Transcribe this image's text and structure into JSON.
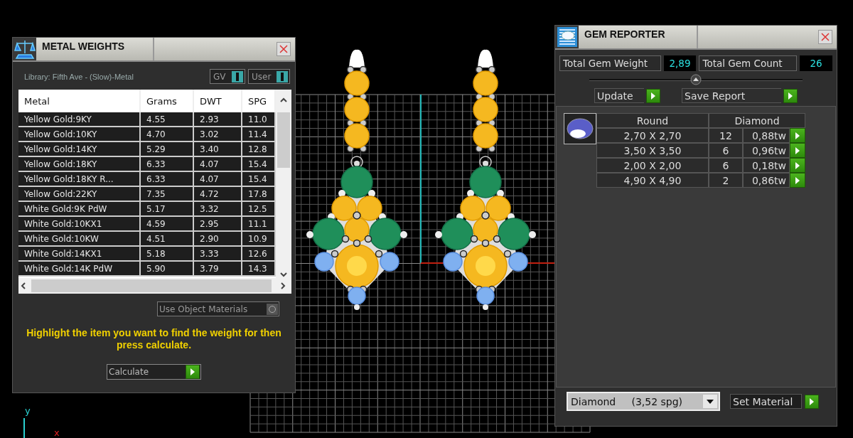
{
  "metal_weights": {
    "title": "METAL WEIGHTS",
    "library": "Library: Fifth Ave - (Slow)-Metal",
    "toggles": [
      {
        "label": "GV",
        "on": true
      },
      {
        "label": "User",
        "on": true
      }
    ],
    "table": {
      "columns": [
        "Metal",
        "Grams",
        "DWT",
        "SPG"
      ],
      "rows": [
        [
          "Yellow Gold:9KY",
          "4.55",
          "2.93",
          "11.0"
        ],
        [
          "Yellow Gold:10KY",
          "4.70",
          "3.02",
          "11.4"
        ],
        [
          "Yellow Gold:14KY",
          "5.29",
          "3.40",
          "12.8"
        ],
        [
          "Yellow Gold:18KY",
          "6.33",
          "4.07",
          "15.4"
        ],
        [
          "Yellow Gold:18KY R...",
          "6.33",
          "4.07",
          "15.4"
        ],
        [
          "Yellow Gold:22KY",
          "7.35",
          "4.72",
          "17.8"
        ],
        [
          "White Gold:9K PdW",
          "5.17",
          "3.32",
          "12.5"
        ],
        [
          "White Gold:10KX1",
          "4.59",
          "2.95",
          "11.1"
        ],
        [
          "White Gold:10KW",
          "4.51",
          "2.90",
          "10.9"
        ],
        [
          "White Gold:14KX1",
          "5.18",
          "3.33",
          "12.6"
        ],
        [
          "White Gold:14K PdW",
          "5.90",
          "3.79",
          "14.3"
        ]
      ]
    },
    "use_object_materials": {
      "label": "Use Object Materials",
      "on": false
    },
    "hint": "Highlight the item you want to find the weight for then press calculate.",
    "calculate_button": "Calculate"
  },
  "viewport": {
    "axis_labels": [
      "y",
      "x"
    ]
  },
  "gem_reporter": {
    "title": "GEM REPORTER",
    "totals": [
      {
        "label": "Total Gem Weight",
        "value": "2,89"
      },
      {
        "label": "Total Gem Count",
        "value": "26"
      }
    ],
    "buttons": [
      "Update",
      "Save Report"
    ],
    "table": {
      "shape": "Round",
      "material": "Diamond",
      "rows": [
        {
          "size": "2,70 X 2,70",
          "count": "12",
          "weight": "0,88tw"
        },
        {
          "size": "3,50 X 3,50",
          "count": "6",
          "weight": "0,96tw"
        },
        {
          "size": "2,00 X 2,00",
          "count": "6",
          "weight": "0,18tw"
        },
        {
          "size": "4,90 X 4,90",
          "count": "2",
          "weight": "0,86tw"
        }
      ]
    },
    "material_dropdown": {
      "value": "Diamond     (3,52 spg)"
    },
    "set_material_button": "Set Material"
  }
}
